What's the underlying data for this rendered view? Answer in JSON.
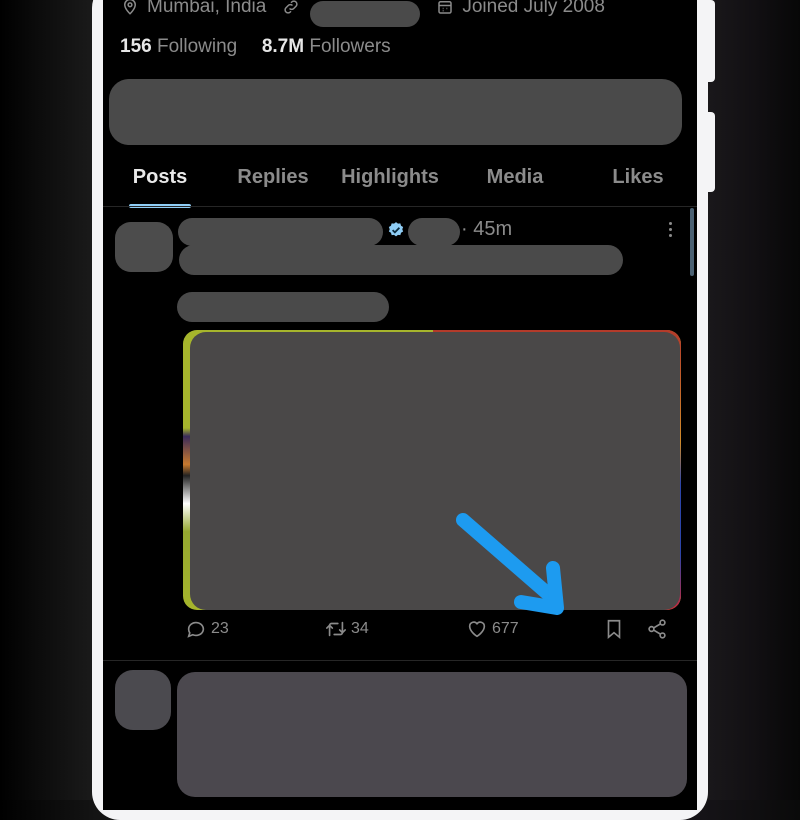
{
  "profile": {
    "location": "Mumbai, India",
    "joined": "Joined July 2008",
    "following_count": "156",
    "following_label": "Following",
    "followers_count": "8.7M",
    "followers_label": "Followers"
  },
  "tabs": [
    {
      "label": "Posts",
      "active": true
    },
    {
      "label": "Replies",
      "active": false
    },
    {
      "label": "Highlights",
      "active": false
    },
    {
      "label": "Media",
      "active": false
    },
    {
      "label": "Likes",
      "active": false
    }
  ],
  "posts": [
    {
      "time": "· 45m",
      "verified": true,
      "actions": {
        "replies": "23",
        "reposts": "34",
        "likes": "677"
      }
    }
  ],
  "colors": {
    "accent": "#8fcdf5",
    "verified": "#8fcdf5",
    "annotation_arrow": "#1d9bf0",
    "redaction": "#4a4a4a",
    "muted_text": "#8b8b8b"
  },
  "icons": {
    "location": "location-pin-icon",
    "link": "link-icon",
    "calendar": "calendar-icon",
    "verified": "verified-badge-icon",
    "more": "more-vertical-icon",
    "reply": "reply-icon",
    "repost": "repost-icon",
    "like": "heart-icon",
    "bookmark": "bookmark-icon",
    "share": "share-icon"
  }
}
